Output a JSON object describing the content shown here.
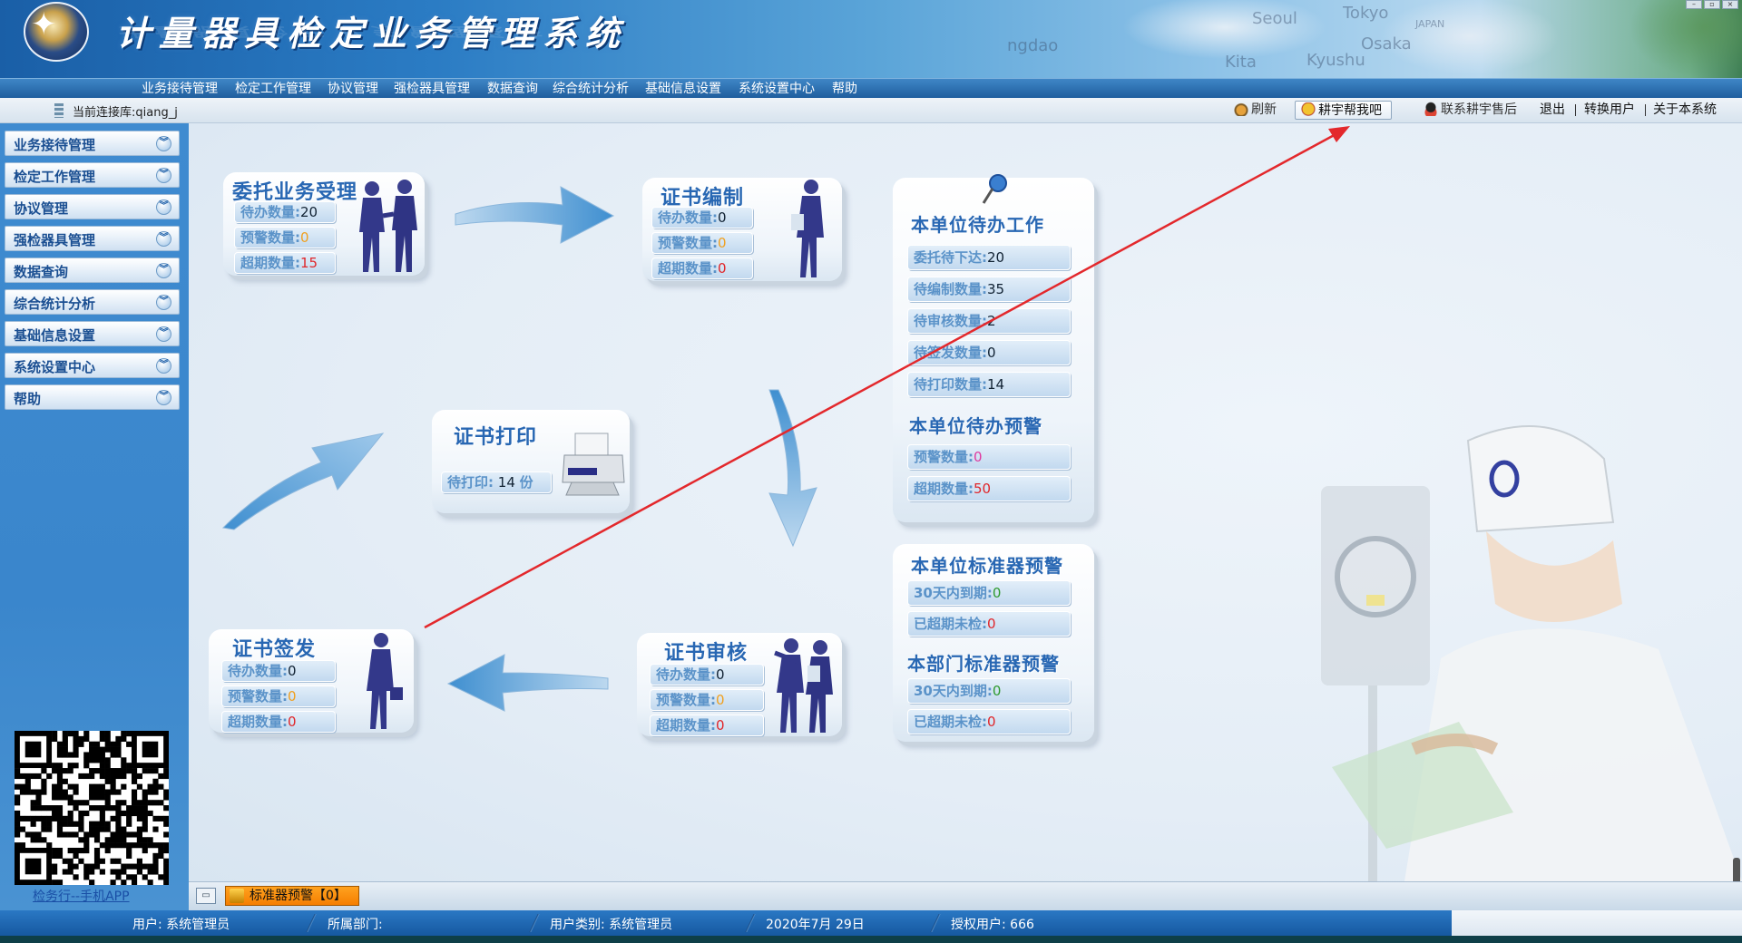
{
  "app": {
    "title": "计量器具检定业务管理系统",
    "map_labels": [
      "Seoul",
      "Tokyo",
      "Osaka",
      "JAPAN",
      "Kyushu",
      "ngdao",
      "Kita"
    ]
  },
  "menu": [
    "业务接待管理",
    "检定工作管理",
    "协议管理",
    "强检器具管理",
    "数据查询",
    "综合统计分析",
    "基础信息设置",
    "系统设置中心",
    "帮助"
  ],
  "toolbar": {
    "db_label": "当前连接库:qiang_j",
    "refresh": "刷新",
    "help_me": "耕宇帮我吧",
    "contact": "联系耕宇售后",
    "exit": "退出",
    "switch_user": "转换用户",
    "about": "关于本系统"
  },
  "sidebar": {
    "items": [
      "业务接待管理",
      "检定工作管理",
      "协议管理",
      "强检器具管理",
      "数据查询",
      "综合统计分析",
      "基础信息设置",
      "系统设置中心",
      "帮助"
    ],
    "qr_caption": "检务行--手机APP"
  },
  "cards": {
    "entrust": {
      "title": "委托业务受理",
      "pending_label": "待办数量:",
      "pending": "20",
      "warn_label": "预警数量:",
      "warn": "0",
      "overdue_label": "超期数量:",
      "overdue": "15"
    },
    "cert_edit": {
      "title": "证书编制",
      "pending_label": "待办数量:",
      "pending": "0",
      "warn_label": "预警数量:",
      "warn": "0",
      "overdue_label": "超期数量:",
      "overdue": "0"
    },
    "cert_print": {
      "title": "证书打印",
      "label": "待打印:",
      "value": "14",
      "unit": "份"
    },
    "cert_issue": {
      "title": "证书签发",
      "pending_label": "待办数量:",
      "pending": "0",
      "warn_label": "预警数量:",
      "warn": "0",
      "overdue_label": "超期数量:",
      "overdue": "0"
    },
    "cert_review": {
      "title": "证书审核",
      "pending_label": "待办数量:",
      "pending": "0",
      "warn_label": "预警数量:",
      "warn": "0",
      "overdue_label": "超期数量:",
      "overdue": "0"
    }
  },
  "unit_todo": {
    "title": "本单位待办工作",
    "items": [
      {
        "label": "委托待下达:",
        "value": "20"
      },
      {
        "label": "待编制数量:",
        "value": "35"
      },
      {
        "label": "待审核数量:",
        "value": "2"
      },
      {
        "label": "待签发数量:",
        "value": "0"
      },
      {
        "label": "待打印数量:",
        "value": "14"
      }
    ],
    "warn_title": "本单位待办预警",
    "warn_items": [
      {
        "label": "预警数量:",
        "value": "0"
      },
      {
        "label": "超期数量:",
        "value": "50"
      }
    ]
  },
  "standard_warn": {
    "unit_title": "本单位标准器预警",
    "unit_items": [
      {
        "label": "30天内到期:",
        "value": "0"
      },
      {
        "label": "已超期未检:",
        "value": "0"
      }
    ],
    "dept_title": "本部门标准器预警",
    "dept_items": [
      {
        "label": "30天内到期:",
        "value": "0"
      },
      {
        "label": "已超期未检:",
        "value": "0"
      }
    ]
  },
  "tabs": {
    "warning_tab": "标准器预警【0】"
  },
  "status": {
    "user": "用户: 系统管理员",
    "dept": "所属部门:",
    "user_type": "用户类别: 系统管理员",
    "date": "2020年7月 29日",
    "licensed": "授权用户: 666"
  },
  "colors": {
    "accent_blue": "#2867b3",
    "warn_orange": "#f0a020",
    "overdue_red": "#e0262a",
    "ok_green": "#2e9a2e",
    "annotation_red": "#e3282c"
  }
}
